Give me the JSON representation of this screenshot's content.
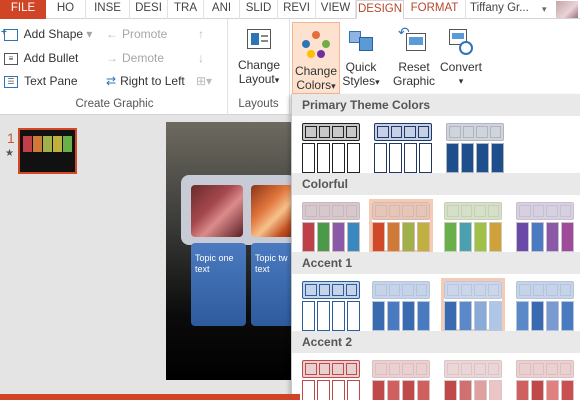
{
  "tabs": [
    "FILE",
    "HO",
    "INSE",
    "DESI",
    "TRA",
    "ANI",
    "SLID",
    "REVI",
    "VIEW",
    "DESIGN",
    "FORMAT"
  ],
  "user": "Tiffany Gr...",
  "ribbon": {
    "add_shape": "Add Shape",
    "add_bullet": "Add Bullet",
    "text_pane": "Text Pane",
    "promote": "Promote",
    "demote": "Demote",
    "right_to_left": "Right to Left",
    "create_graphic_group": "Create Graphic",
    "change_layout": [
      "Change",
      "Layout"
    ],
    "layouts_group": "Layouts",
    "change_colors": [
      "Change",
      "Colors"
    ],
    "quick_styles": [
      "Quick",
      "Styles"
    ],
    "reset_graphic": [
      "Reset",
      "Graphic"
    ],
    "convert": "Convert"
  },
  "gallery": {
    "sections": [
      {
        "title": "Primary Theme Colors",
        "swatches": [
          {
            "top": "#ffffff",
            "topfill": "#c8c8c8",
            "bottom": [
              "#ffffff",
              "#ffffff",
              "#ffffff",
              "#ffffff"
            ],
            "border": "#222222"
          },
          {
            "top": "#ffffff",
            "topfill": "#c6d0e6",
            "bottom": [
              "#ffffff",
              "#ffffff",
              "#ffffff",
              "#ffffff"
            ],
            "border": "#1f3864"
          },
          {
            "top": "#d9dbe0",
            "topfill": "#d0d4dc",
            "bottom": [
              "#1f4e8c",
              "#1f4e8c",
              "#1f4e8c",
              "#1f4e8c"
            ],
            "border": "#b0b4bc"
          }
        ]
      },
      {
        "title": "Colorful",
        "swatches": [
          {
            "topfill": "#d6c8cc",
            "bottom": [
              "#c0404a",
              "#4a9a4a",
              "#8a5aa8",
              "#3a88c0"
            ],
            "border": "#c9b9bd"
          },
          {
            "topfill": "#e6c6b8",
            "bottom": [
              "#d04a2a",
              "#d07a3a",
              "#a0b04a",
              "#c0b040"
            ],
            "border": "#d9b9ab",
            "selected": true
          },
          {
            "topfill": "#d6e0c8",
            "bottom": [
              "#6ab04a",
              "#4aa0b0",
              "#a0c04a",
              "#d0a03a"
            ],
            "border": "#c6d0b8"
          },
          {
            "topfill": "#d6d0e0",
            "bottom": [
              "#6a4aa8",
              "#4a7ac0",
              "#8a5aa8",
              "#a04a9a"
            ],
            "border": "#c6c0d0"
          }
        ]
      },
      {
        "title": "Accent 1",
        "swatches": [
          {
            "topfill": "#c6d4ea",
            "bottom": [
              "#ffffff",
              "#ffffff",
              "#ffffff",
              "#ffffff"
            ],
            "border": "#2e5c9c"
          },
          {
            "topfill": "#c6d4ea",
            "bottom": [
              "#3a6ab0",
              "#4a7ac0",
              "#3a6ab0",
              "#4a7ac0"
            ],
            "border": "#b6c4da"
          },
          {
            "topfill": "#ccd6ea",
            "bottom": [
              "#3a6ab0",
              "#5a88c8",
              "#8aaad8",
              "#b0c6e6"
            ],
            "border": "#bcc6da",
            "selected": true
          },
          {
            "topfill": "#c6d4ea",
            "bottom": [
              "#5a88c8",
              "#3a6ab0",
              "#7a9ad0",
              "#4a7ac0"
            ],
            "border": "#b6c4da"
          }
        ]
      },
      {
        "title": "Accent 2",
        "swatches": [
          {
            "topfill": "#ead0d0",
            "bottom": [
              "#ffffff",
              "#ffffff",
              "#ffffff",
              "#ffffff"
            ],
            "border": "#c04a4a"
          },
          {
            "topfill": "#ead0d0",
            "bottom": [
              "#c04a4a",
              "#d06060",
              "#c04a4a",
              "#d06060"
            ],
            "border": "#dac0c0"
          },
          {
            "topfill": "#ead6d6",
            "bottom": [
              "#c04a4a",
              "#d07070",
              "#e0a0a0",
              "#ecc6c6"
            ],
            "border": "#dac6c6"
          },
          {
            "topfill": "#ead0d0",
            "bottom": [
              "#d06060",
              "#c04a4a",
              "#e08080",
              "#c85050"
            ],
            "border": "#dac0c0"
          }
        ]
      }
    ]
  },
  "slides": {
    "number": "1",
    "star": "★"
  },
  "slide": {
    "card1": "Topic one text",
    "card2": "Topic tw text"
  },
  "colors": {
    "accent": "#d04525",
    "ribbon_tab_active": "#b7472a"
  }
}
